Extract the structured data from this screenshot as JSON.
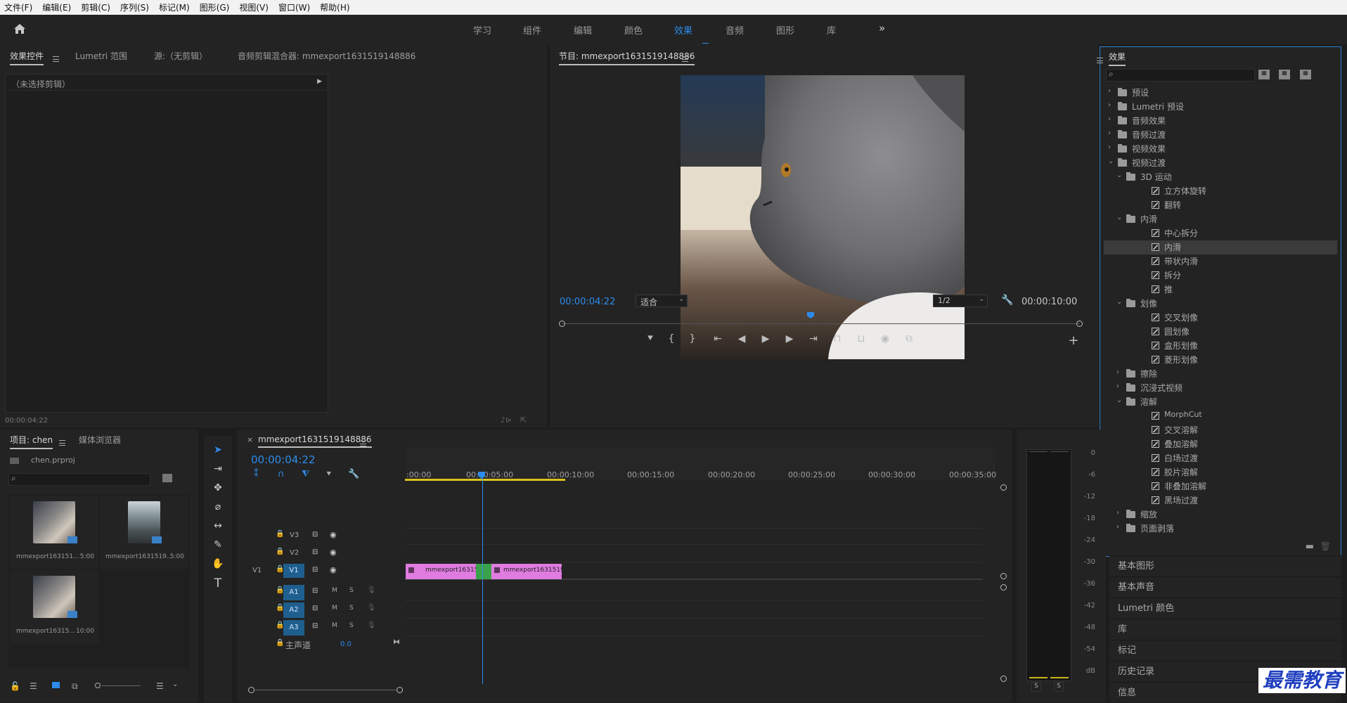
{
  "menubar": {
    "items": [
      "文件(F)",
      "编辑(E)",
      "剪辑(C)",
      "序列(S)",
      "标记(M)",
      "图形(G)",
      "视图(V)",
      "窗口(W)",
      "帮助(H)"
    ]
  },
  "workspaces": {
    "tabs": [
      "学习",
      "组件",
      "编辑",
      "颜色",
      "效果",
      "音频",
      "图形",
      "库"
    ],
    "active": "效果",
    "more": "»"
  },
  "source_panel": {
    "tabs": [
      "效果控件",
      "Lumetri 范围",
      "源:（无剪辑）",
      "音频剪辑混合器: mmexport1631519148886"
    ],
    "no_clip": "（未选择剪辑）",
    "timecode": "00:00:04:22"
  },
  "program": {
    "title": "节目: mmexport1631519148886",
    "timecode": "00:00:04:22",
    "fit": "适合",
    "resolution": "1/2",
    "duration": "00:00:10:00",
    "playhead_fraction": 0.48
  },
  "effects": {
    "title": "效果",
    "tree": [
      {
        "label": "预设",
        "level": 0,
        "kind": "preset-folder",
        "chev": "right"
      },
      {
        "label": "Lumetri 预设",
        "level": 0,
        "kind": "preset-folder",
        "chev": "right"
      },
      {
        "label": "音频效果",
        "level": 0,
        "kind": "folder",
        "chev": "right"
      },
      {
        "label": "音频过渡",
        "level": 0,
        "kind": "folder",
        "chev": "right"
      },
      {
        "label": "视频效果",
        "level": 0,
        "kind": "folder",
        "chev": "right"
      },
      {
        "label": "视频过渡",
        "level": 0,
        "kind": "folder",
        "chev": "down"
      },
      {
        "label": "3D 运动",
        "level": 1,
        "kind": "folder",
        "chev": "down"
      },
      {
        "label": "立方体旋转",
        "level": 2,
        "kind": "effect"
      },
      {
        "label": "翻转",
        "level": 2,
        "kind": "effect"
      },
      {
        "label": "内滑",
        "level": 1,
        "kind": "folder",
        "chev": "down"
      },
      {
        "label": "中心拆分",
        "level": 2,
        "kind": "effect"
      },
      {
        "label": "内滑",
        "level": 2,
        "kind": "effect",
        "selected": true
      },
      {
        "label": "带状内滑",
        "level": 2,
        "kind": "effect"
      },
      {
        "label": "拆分",
        "level": 2,
        "kind": "effect"
      },
      {
        "label": "推",
        "level": 2,
        "kind": "effect"
      },
      {
        "label": "划像",
        "level": 1,
        "kind": "folder",
        "chev": "down"
      },
      {
        "label": "交叉划像",
        "level": 2,
        "kind": "effect"
      },
      {
        "label": "圆划像",
        "level": 2,
        "kind": "effect"
      },
      {
        "label": "盒形划像",
        "level": 2,
        "kind": "effect"
      },
      {
        "label": "菱形划像",
        "level": 2,
        "kind": "effect"
      },
      {
        "label": "擦除",
        "level": 1,
        "kind": "folder",
        "chev": "right"
      },
      {
        "label": "沉浸式视频",
        "level": 1,
        "kind": "folder",
        "chev": "right"
      },
      {
        "label": "溶解",
        "level": 1,
        "kind": "folder",
        "chev": "down"
      },
      {
        "label": "MorphCut",
        "level": 2,
        "kind": "effect"
      },
      {
        "label": "交叉溶解",
        "level": 2,
        "kind": "effect"
      },
      {
        "label": "叠加溶解",
        "level": 2,
        "kind": "effect"
      },
      {
        "label": "白场过渡",
        "level": 2,
        "kind": "effect"
      },
      {
        "label": "胶片溶解",
        "level": 2,
        "kind": "effect"
      },
      {
        "label": "非叠加溶解",
        "level": 2,
        "kind": "effect"
      },
      {
        "label": "黑场过渡",
        "level": 2,
        "kind": "effect"
      },
      {
        "label": "缩放",
        "level": 1,
        "kind": "folder",
        "chev": "right"
      },
      {
        "label": "页面剥落",
        "level": 1,
        "kind": "folder",
        "chev": "right"
      }
    ]
  },
  "side_panels": [
    "基本图形",
    "基本声音",
    "Lumetri 颜色",
    "库",
    "标记",
    "历史记录",
    "信息"
  ],
  "project": {
    "tabs": [
      "项目: chen",
      "媒体浏览器"
    ],
    "file": "chen.prproj",
    "items": [
      {
        "name": "mmexport163151...",
        "dur": "5:00"
      },
      {
        "name": "mmexport1631519...",
        "dur": "5:00"
      },
      {
        "name": "mmexport16315...",
        "dur": "10:00"
      }
    ]
  },
  "timeline": {
    "title": "mmexport1631519148886",
    "timecode": "00:00:04:22",
    "ruler": [
      ":00:00",
      "00:00:05:00",
      "00:00:10:00",
      "00:00:15:00",
      "00:00:20:00",
      "00:00:25:00",
      "00:00:30:00",
      "00:00:35:00"
    ],
    "video_tracks": [
      "V3",
      "V2",
      "V1"
    ],
    "audio_tracks": [
      "A1",
      "A2",
      "A3"
    ],
    "source_patch": "V1",
    "master": "主声道",
    "master_value": "0.0",
    "clips": [
      "mmexport16315191",
      "mmexport16315191"
    ],
    "m_label": "M",
    "s_label": "S"
  },
  "meter": {
    "db": [
      "0",
      "-6",
      "-12",
      "-18",
      "-24",
      "-30",
      "-36",
      "-42",
      "-48",
      "-54",
      "dB"
    ],
    "solo": [
      "S",
      "S"
    ]
  },
  "watermark": "最需教育",
  "colors": {
    "accent": "#2d8ceb",
    "clip": "#e07be0",
    "transition": "#3aa34a",
    "audio_track": "#1f5f8f"
  }
}
